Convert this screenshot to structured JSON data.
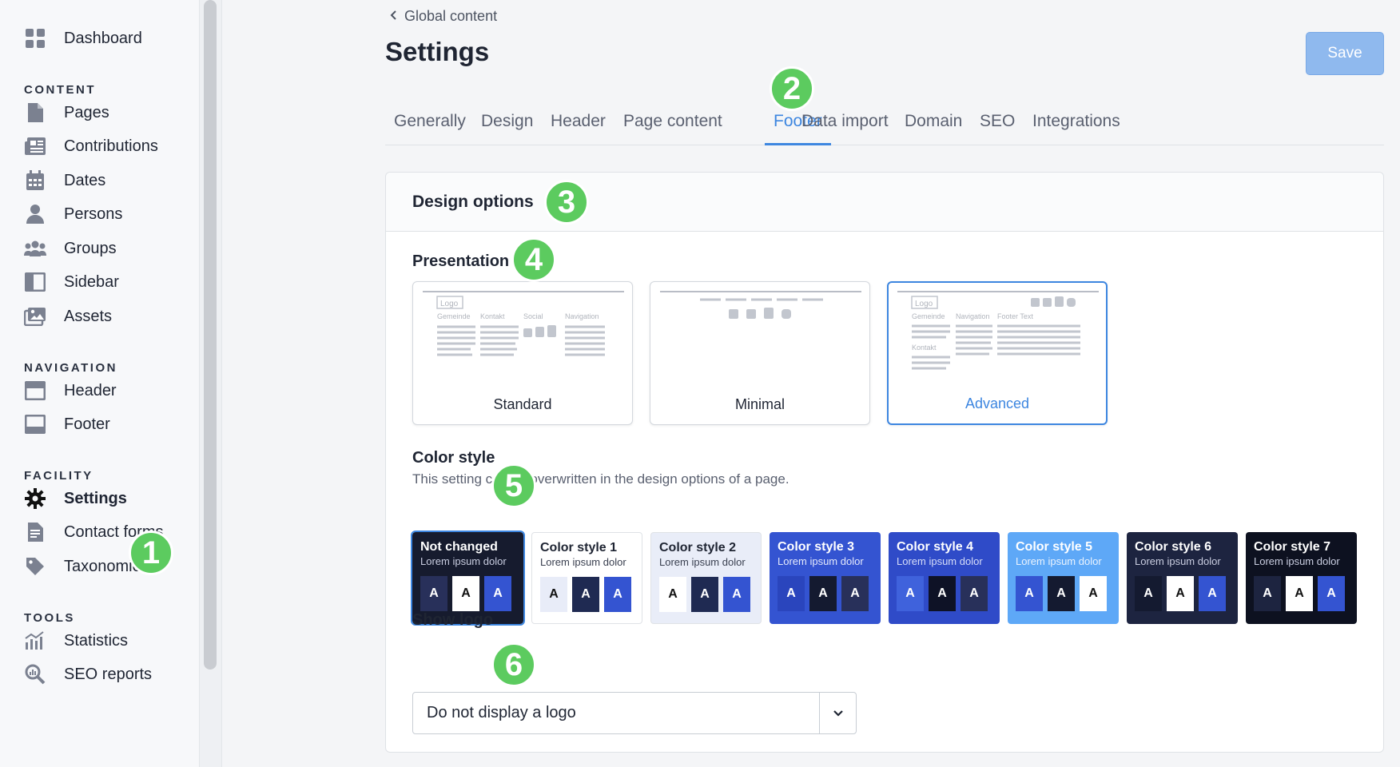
{
  "sidebar": {
    "dashboard": "Dashboard",
    "content_head": "CONTENT",
    "content": [
      "Pages",
      "Contributions",
      "Dates",
      "Persons",
      "Groups",
      "Sidebar",
      "Assets"
    ],
    "navigation_head": "NAVIGATION",
    "navigation": [
      "Header",
      "Footer"
    ],
    "facility_head": "FACILITY",
    "facility": [
      "Settings",
      "Contact forms",
      "Taxonomies"
    ],
    "tools_head": "TOOLS",
    "tools": [
      "Statistics",
      "SEO reports"
    ]
  },
  "header": {
    "breadcrumb": "Global content",
    "title": "Settings",
    "save_label": "Save"
  },
  "tabs": [
    "Generally",
    "Design",
    "Header",
    "Page content",
    "Footer",
    "Data import",
    "Domain",
    "SEO",
    "Integrations"
  ],
  "active_tab": "Footer",
  "card": {
    "title": "Design options",
    "presentation_label": "Presentation",
    "presentations": [
      "Standard",
      "Minimal",
      "Advanced"
    ],
    "selected_presentation": "Advanced",
    "preview_labels": {
      "logo": "Logo",
      "gemeinde": "Gemeinde",
      "kontakt": "Kontakt",
      "social": "Social",
      "navigation": "Navigation",
      "footer_text": "Footer Text"
    },
    "color_style_label": "Color style",
    "color_style_help": "This setting can be overwritten in the design options of a page.",
    "color_styles": [
      {
        "name": "Not changed",
        "sub": "Lorem ipsum dolor",
        "bg": "#161b2e",
        "fg": "#ffffff",
        "subfg": "#c9cde0",
        "squares": [
          "#28305a",
          "#ffffff",
          "#3454d1"
        ]
      },
      {
        "name": "Color style 1",
        "sub": "Lorem ipsum dolor",
        "bg": "#ffffff",
        "fg": "#1f2533",
        "subfg": "#3a4050",
        "squares": [
          "#e8ecf8",
          "#1f2a52",
          "#3454d1"
        ]
      },
      {
        "name": "Color style 2",
        "sub": "Lorem ipsum dolor",
        "bg": "#e9edf8",
        "fg": "#1f2533",
        "subfg": "#3a4050",
        "squares": [
          "#ffffff",
          "#1f2a52",
          "#3454d1"
        ]
      },
      {
        "name": "Color style 3",
        "sub": "Lorem ipsum dolor",
        "bg": "#3454d1",
        "fg": "#ffffff",
        "subfg": "#e4e9fb",
        "squares": [
          "#2a45bd",
          "#141a30",
          "#28305a"
        ]
      },
      {
        "name": "Color style 4",
        "sub": "Lorem ipsum dolor",
        "bg": "#2f4bc8",
        "fg": "#ffffff",
        "subfg": "#d6ddf8",
        "squares": [
          "#3f62dc",
          "#0e1226",
          "#28305a"
        ]
      },
      {
        "name": "Color style 5",
        "sub": "Lorem ipsum dolor",
        "bg": "#5ea8f7",
        "fg": "#ffffff",
        "subfg": "#eaf3fe",
        "squares": [
          "#3454d1",
          "#141a30",
          "#ffffff"
        ]
      },
      {
        "name": "Color style 6",
        "sub": "Lorem ipsum dolor",
        "bg": "#1d2440",
        "fg": "#ffffff",
        "subfg": "#c9cde0",
        "squares": [
          "#141a30",
          "#ffffff",
          "#3454d1"
        ]
      },
      {
        "name": "Color style 7",
        "sub": "Lorem ipsum dolor",
        "bg": "#0d1120",
        "fg": "#ffffff",
        "subfg": "#c9cde0",
        "squares": [
          "#1d2440",
          "#ffffff",
          "#3454d1"
        ]
      }
    ],
    "swatch_letter": "A",
    "show_logo_label": "Show logo",
    "show_logo_value": "Do not display a logo"
  },
  "badges": [
    "1",
    "2",
    "3",
    "4",
    "5",
    "6"
  ],
  "colors": {
    "accent": "#3d86e0",
    "badge": "#5ccb5f"
  }
}
